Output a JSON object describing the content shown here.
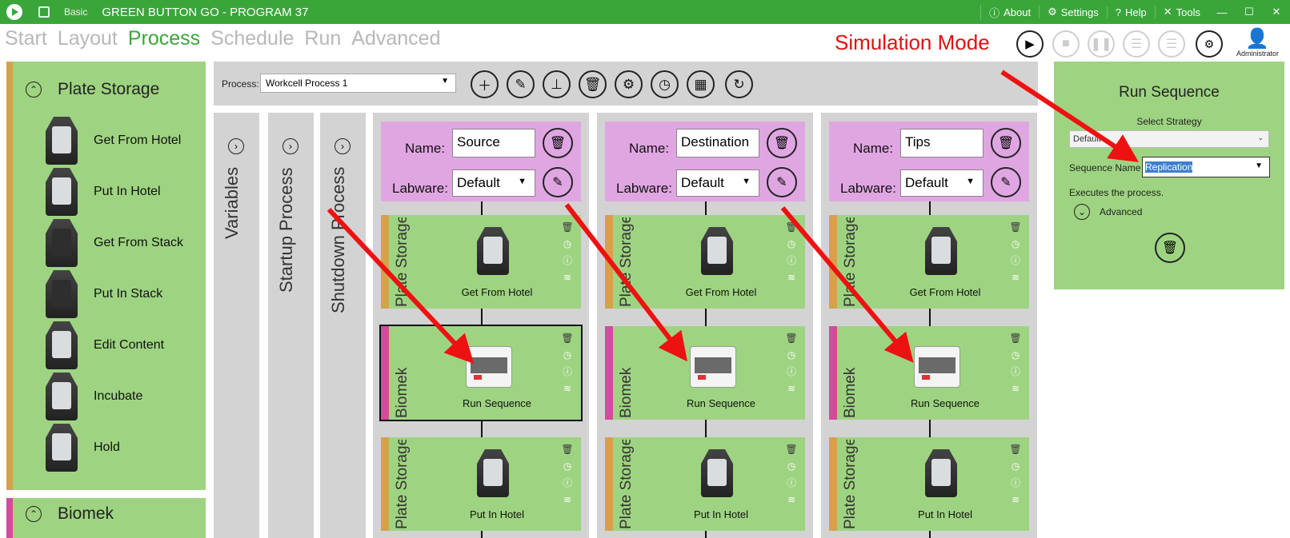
{
  "titlebar": {
    "mode": "Basic",
    "title": "GREEN BUTTON GO - PROGRAM 37",
    "about": "About",
    "settings": "Settings",
    "help": "Help",
    "tools": "Tools",
    "bg_color": "#3aa63a"
  },
  "nav": {
    "tabs": [
      "Start",
      "Layout",
      "Process",
      "Schedule",
      "Run",
      "Advanced"
    ],
    "active": "Process"
  },
  "simulation_label": "Simulation Mode",
  "user": {
    "name": "Administrator"
  },
  "left_panel": {
    "sections": [
      {
        "title": "Plate Storage",
        "expanded": true,
        "color": "#d4a24b",
        "items": [
          "Get From Hotel",
          "Put In Hotel",
          "Get From Stack",
          "Put In Stack",
          "Edit Content",
          "Incubate",
          "Hold"
        ]
      },
      {
        "title": "Biomek",
        "expanded": true,
        "color": "#d54a9b"
      }
    ]
  },
  "process_toolbar": {
    "label": "Process:",
    "selected": "Workcell Process 1"
  },
  "vertical_tabs": [
    "Variables",
    "Startup Process",
    "Shutdown Process"
  ],
  "columns": [
    {
      "name": "Source",
      "labware": "Default",
      "steps": [
        {
          "group": "Plate Storage",
          "label": "Get From Hotel"
        },
        {
          "group": "Biomek",
          "label": "Run Sequence",
          "selected": true
        },
        {
          "group": "Plate Storage",
          "label": "Put In Hotel"
        }
      ]
    },
    {
      "name": "Destination",
      "labware": "Default",
      "steps": [
        {
          "group": "Plate Storage",
          "label": "Get From Hotel"
        },
        {
          "group": "Biomek",
          "label": "Run Sequence"
        },
        {
          "group": "Plate Storage",
          "label": "Put In Hotel"
        }
      ]
    },
    {
      "name": "Tips",
      "labware": "Default",
      "steps": [
        {
          "group": "Plate Storage",
          "label": "Get From Hotel"
        },
        {
          "group": "Biomek",
          "label": "Run Sequence"
        },
        {
          "group": "Plate Storage",
          "label": "Put In Hotel"
        }
      ]
    }
  ],
  "config_labels": {
    "name": "Name:",
    "labware": "Labware:"
  },
  "right_panel": {
    "title": "Run Sequence",
    "strategy_label": "Select Strategy",
    "strategy_value": "Default",
    "sequence_label": "Sequence Name",
    "sequence_value": "Replication",
    "description": "Executes the process.",
    "advanced": "Advanced"
  },
  "colors": {
    "accent_green": "#3aa63a",
    "panel_green": "#9ed481",
    "config_pink": "#e0a6e2",
    "biomek_bar": "#d54a9b",
    "storage_bar": "#d4a24b",
    "arrow_red": "#ee1111"
  }
}
